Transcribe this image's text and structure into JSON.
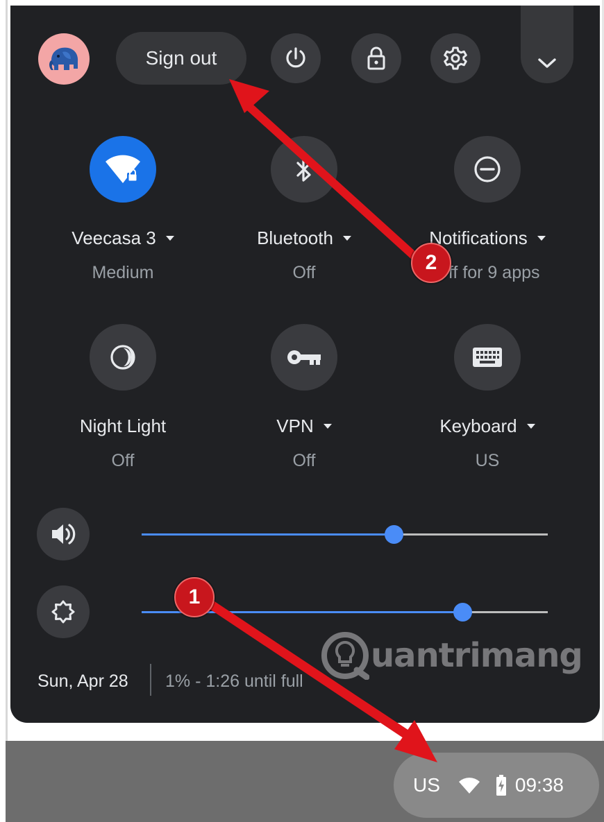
{
  "header": {
    "sign_out_label": "Sign out"
  },
  "tiles": [
    {
      "label": "Veecasa 3",
      "sublabel": "Medium",
      "icon": "wifi-locked-icon",
      "active": true,
      "has_caret": true
    },
    {
      "label": "Bluetooth",
      "sublabel": "Off",
      "icon": "bluetooth-icon",
      "active": false,
      "has_caret": true
    },
    {
      "label": "Notifications",
      "sublabel": "Off for 9 apps",
      "icon": "do-not-disturb-icon",
      "active": false,
      "has_caret": true
    },
    {
      "label": "Night Light",
      "sublabel": "Off",
      "icon": "night-light-icon",
      "active": false,
      "has_caret": false
    },
    {
      "label": "VPN",
      "sublabel": "Off",
      "icon": "vpn-key-icon",
      "active": false,
      "has_caret": true
    },
    {
      "label": "Keyboard",
      "sublabel": "US",
      "icon": "keyboard-icon",
      "active": false,
      "has_caret": true
    }
  ],
  "sliders": {
    "volume_level": 0.62,
    "brightness_level": 0.79
  },
  "footer": {
    "date": "Sun, Apr 28",
    "battery_status": "1% - 1:26 until full"
  },
  "watermark": {
    "text": "uantrimang"
  },
  "shelf": {
    "keyboard_layout": "US",
    "time": "09:38"
  },
  "annotations": {
    "badge_1": "1",
    "badge_2": "2"
  },
  "colors": {
    "panel_bg": "#202124",
    "accent": "#1a73e8",
    "slider": "#4a8cf7",
    "annotation_red": "#e0141b"
  }
}
